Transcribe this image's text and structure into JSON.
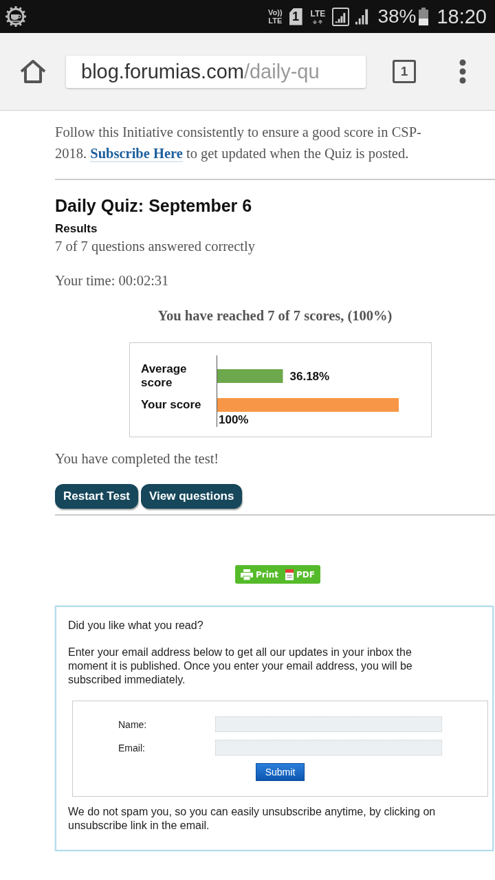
{
  "status_bar": {
    "volte_top": "Vo))",
    "volte_bottom": "LTE",
    "sim_slot": "1",
    "network": "LTE",
    "battery_text": "38%",
    "time": "18:20"
  },
  "browser": {
    "url_host": "blog.forumias.com",
    "url_path": "/daily-qu",
    "tab_count": "1"
  },
  "intro": {
    "text_before": "Follow this Initiative consistently to ensure a good score in CSP-2018.",
    "link": "Subscribe Here",
    "text_after": "to get updated when the Quiz is posted."
  },
  "quiz": {
    "title": "Daily Quiz: September 6",
    "results_heading": "Results",
    "answered": "7 of 7 questions answered correctly",
    "time": "Your time: 00:02:31",
    "score_summary": "You have reached 7 of 7 scores, (100%)",
    "chart_data": {
      "type": "bar",
      "orientation": "horizontal",
      "categories": [
        "Average score",
        "Your score"
      ],
      "series": [
        {
          "color": "#6ea84c",
          "values": [
            36.18,
            null
          ],
          "value_labels": [
            "36.18%",
            null
          ]
        },
        {
          "color": "#f79646",
          "values": [
            null,
            100
          ],
          "value_labels": [
            null,
            "100%"
          ]
        }
      ],
      "stacked": true
    },
    "completion": "You have completed the test!",
    "buttons": [
      {
        "label": "Restart Test"
      },
      {
        "label": "View questions"
      }
    ]
  },
  "print_button": {
    "print_label": "Print",
    "pdf_label": "PDF"
  },
  "subscribe_box": {
    "question": "Did you like what you read?",
    "description": "Enter your email address below to get all our updates in your inbox the moment it is published. Once you enter your email address, you will be subscribed immediately.",
    "fields": [
      {
        "label": "Name:"
      },
      {
        "label": "Email:"
      }
    ],
    "submit": "Submit",
    "note": "We do not spam you, so you can easily unsubscribe anytime, by clicking on unsubscribe link in the email."
  }
}
